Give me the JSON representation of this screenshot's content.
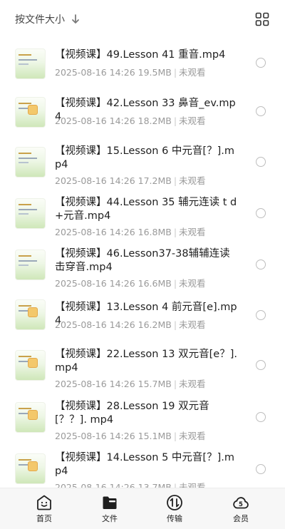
{
  "toolbar": {
    "sort_label": "按文件大小",
    "sort_direction_icon": "arrow-down-icon",
    "view_toggle_icon": "grid-view-icon"
  },
  "files": [
    {
      "title": "【视频课】49.Lesson 41 重音.mp4",
      "date": "2025-08-16 14:26",
      "size": "19.5MB",
      "status": "未观看"
    },
    {
      "title": "【视频课】42.Lesson 33 鼻音_ev.mp4",
      "date": "2025-08-16 14:26",
      "size": "18.2MB",
      "status": "未观看"
    },
    {
      "title": "【视频课】15.Lesson 6 中元音[？].mp4",
      "date": "2025-08-16 14:26",
      "size": "17.2MB",
      "status": "未观看"
    },
    {
      "title": "【视频课】44.Lesson 35 辅元连读 t d +元音.mp4",
      "date": "2025-08-16 14:26",
      "size": "16.8MB",
      "status": "未观看"
    },
    {
      "title": "【视频课】46.Lesson37-38辅辅连读击穿音.mp4",
      "date": "2025-08-16 14:26",
      "size": "16.6MB",
      "status": "未观看"
    },
    {
      "title": "【视频课】13.Lesson 4 前元音[e].mp4",
      "date": "2025-08-16 14:26",
      "size": "16.2MB",
      "status": "未观看"
    },
    {
      "title": "【视频课】22.Lesson 13 双元音[e？]. mp4",
      "date": "2025-08-16 14:26",
      "size": "15.7MB",
      "status": "未观看"
    },
    {
      "title": "【视频课】28.Lesson 19 双元音[？？]. mp4",
      "date": "2025-08-16 14:26",
      "size": "15.1MB",
      "status": "未观看"
    },
    {
      "title": "【视频课】14.Lesson 5 中元音[？].mp4",
      "date": "2025-08-16 14:26",
      "size": "13.7MB",
      "status": "未观看"
    }
  ],
  "tabbar": {
    "items": [
      {
        "label": "首页",
        "icon": "home-smile-icon"
      },
      {
        "label": "文件",
        "icon": "folder-icon"
      },
      {
        "label": "传输",
        "icon": "transfer-icon"
      },
      {
        "label": "会员",
        "icon": "vip-cloud-icon"
      }
    ],
    "active": "文件"
  },
  "colors": {
    "text": "#1f1f1f",
    "meta": "#9a9a9a",
    "tabbar_bg": "#f7f7f7"
  }
}
